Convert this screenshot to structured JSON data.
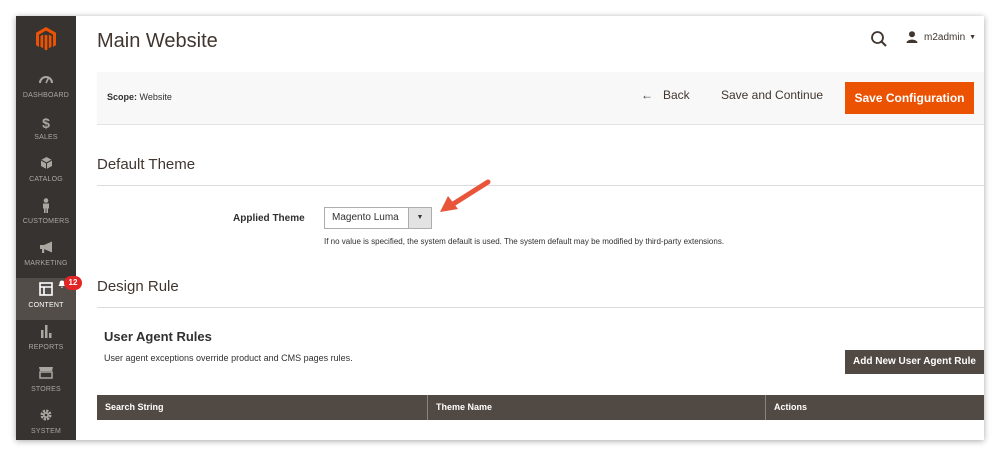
{
  "sidebar": {
    "items": [
      {
        "label": "DASHBOARD",
        "icon": "dashboard-icon"
      },
      {
        "label": "SALES",
        "icon": "dollar-icon"
      },
      {
        "label": "CATALOG",
        "icon": "cube-icon"
      },
      {
        "label": "CUSTOMERS",
        "icon": "person-icon"
      },
      {
        "label": "MARKETING",
        "icon": "megaphone-icon"
      },
      {
        "label": "CONTENT",
        "icon": "layout-icon",
        "active": true,
        "badge": "12"
      },
      {
        "label": "REPORTS",
        "icon": "bar-chart-icon"
      },
      {
        "label": "STORES",
        "icon": "store-icon"
      },
      {
        "label": "SYSTEM",
        "icon": "gear-icon"
      }
    ]
  },
  "header": {
    "title": "Main Website",
    "username": "m2admin"
  },
  "action_bar": {
    "scope_label": "Scope:",
    "scope_value": "Website",
    "back_label": "Back",
    "save_continue_label": "Save and Continue",
    "save_config_label": "Save Configuration"
  },
  "default_theme": {
    "title": "Default Theme",
    "field_label": "Applied Theme",
    "selected_value": "Magento Luma",
    "note": "If no value is specified, the system default is used. The system default may be modified by third-party extensions."
  },
  "design_rule": {
    "title": "Design Rule",
    "subtitle": "User Agent Rules",
    "description": "User agent exceptions override product and CMS pages rules.",
    "add_button_label": "Add New User Agent Rule",
    "columns": [
      "Search String",
      "Theme Name",
      "Actions"
    ]
  },
  "colors": {
    "sidebar_bg": "#373330",
    "accent": "#eb5202",
    "dark_button": "#514943",
    "badge": "#e22626",
    "pointer_arrow": "#e8553a"
  }
}
